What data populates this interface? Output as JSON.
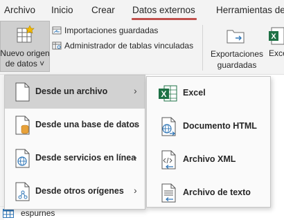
{
  "tabs": [
    {
      "label": "Archivo"
    },
    {
      "label": "Inicio"
    },
    {
      "label": "Crear"
    },
    {
      "label": "Datos externos"
    },
    {
      "label": "Herramientas de"
    }
  ],
  "ribbon": {
    "nuevo_line1": "Nuevo origen",
    "nuevo_line2": "de datos ˅",
    "importaciones": "Importaciones guardadas",
    "administrador": "Administrador de tablas vinculadas",
    "exportaciones_line1": "Exportaciones",
    "exportaciones_line2": "guardadas",
    "excel_partial": "Exce"
  },
  "menu": {
    "items": [
      {
        "label": "Desde un archivo",
        "icon": "file-icon",
        "arrow": "›"
      },
      {
        "label": "Desde una base de datos",
        "icon": "database-file-icon",
        "arrow": "›"
      },
      {
        "label": "Desde servicios en línea",
        "icon": "online-services-icon",
        "arrow": "›"
      },
      {
        "label": "Desde otros orígenes",
        "icon": "other-sources-icon",
        "arrow": "›"
      }
    ]
  },
  "submenu": {
    "items": [
      {
        "label": "Excel",
        "icon": "excel-icon"
      },
      {
        "label": "Documento HTML",
        "icon": "html-document-icon"
      },
      {
        "label": "Archivo XML",
        "icon": "xml-file-icon"
      },
      {
        "label": "Archivo de texto",
        "icon": "text-file-icon"
      }
    ]
  },
  "sheet": {
    "bottom_label": "espurnes"
  },
  "colors": {
    "accent": "#c0504d",
    "excel_green": "#1e7145",
    "icon_blue": "#2e75b6",
    "db_orange": "#e8a23a"
  }
}
